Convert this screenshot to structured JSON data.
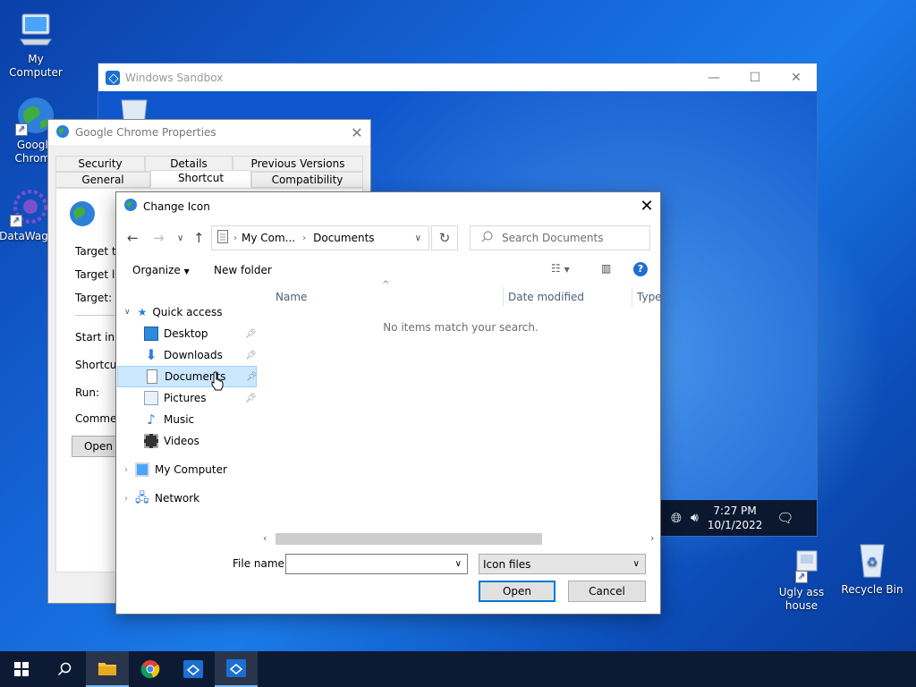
{
  "desktop": {
    "icons": [
      {
        "label": "My Computer"
      },
      {
        "label": "Google Chrome"
      },
      {
        "label": "DataWagon"
      },
      {
        "label": "Ugly ass house"
      },
      {
        "label": "Recycle Bin"
      }
    ]
  },
  "sandbox": {
    "title": "Windows Sandbox",
    "clock_time": "7:27 PM",
    "clock_date": "10/1/2022"
  },
  "props": {
    "title": "Google Chrome Properties",
    "tabs_top": [
      "Security",
      "Details",
      "Previous Versions"
    ],
    "tabs_bottom": [
      "General",
      "Shortcut",
      "Compatibility"
    ],
    "active_tab": "Shortcut",
    "labels": [
      "Target typ",
      "Target loc",
      "Target:",
      "Start in:",
      "Shortcut k",
      "Run:",
      "Comment:"
    ],
    "open_button": "Open"
  },
  "dialog": {
    "title": "Change Icon",
    "breadcrumb": [
      "My Com...",
      "Documents"
    ],
    "search_placeholder": "Search Documents",
    "organize": "Organize",
    "new_folder": "New folder",
    "columns": [
      "Name",
      "Date modified",
      "Type"
    ],
    "empty_message": "No items match your search.",
    "nav": {
      "quick_access": "Quick access",
      "items": [
        {
          "label": "Desktop",
          "pinned": true
        },
        {
          "label": "Downloads",
          "pinned": true
        },
        {
          "label": "Documents",
          "pinned": true,
          "selected": true
        },
        {
          "label": "Pictures",
          "pinned": true
        },
        {
          "label": "Music",
          "pinned": false
        },
        {
          "label": "Videos",
          "pinned": false
        }
      ],
      "my_computer": "My Computer",
      "network": "Network"
    },
    "file_name_label": "File name:",
    "file_name_value": "",
    "filter": "Icon files",
    "open_button": "Open",
    "cancel_button": "Cancel"
  },
  "colors": {
    "accent": "#0078d7",
    "selection": "#cce8ff",
    "taskbar": "#0d1a33"
  }
}
